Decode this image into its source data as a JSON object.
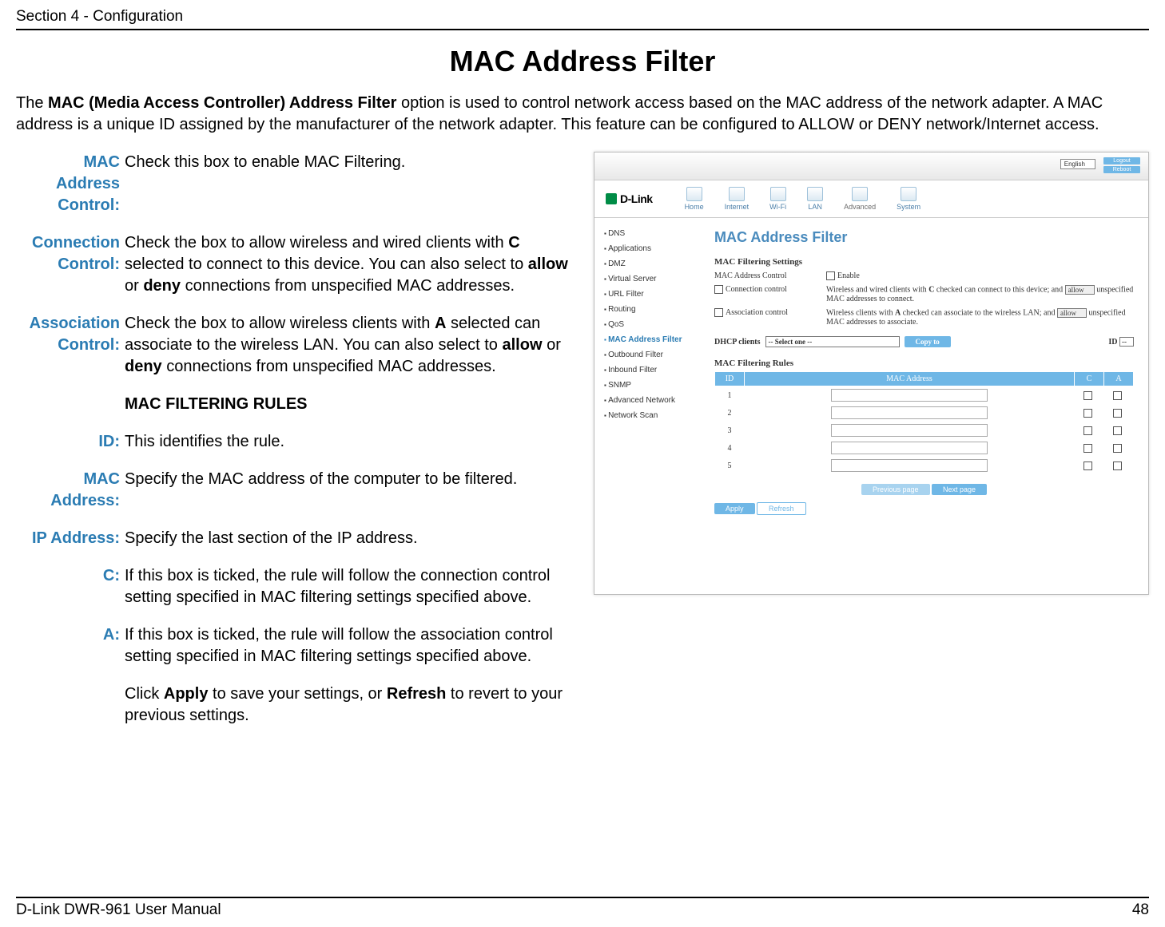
{
  "header": {
    "section": "Section 4 - Configuration"
  },
  "title": "MAC Address Filter",
  "intro": {
    "pre": "The ",
    "bold1": "MAC (Media Access Controller) Address Filter",
    "rest": " option is used to control network access based on the MAC address of the network adapter. A MAC address is a unique ID assigned by the manufacturer of the network adapter. This feature can be configured to ALLOW or DENY network/Internet access."
  },
  "defs": {
    "mac_addr_control": {
      "label": "MAC Address Control:",
      "body": "Check this box to enable MAC Filtering."
    },
    "connection_control": {
      "label": "Connection Control:",
      "body_pre": "Check the box to allow wireless and wired clients with ",
      "bold_c": "C",
      "body_mid": " selected to connect to this device. You can also select to ",
      "bold_allow": "allow",
      "or": " or ",
      "bold_deny": "deny",
      "body_post": " connections from unspecified MAC addresses."
    },
    "association_control": {
      "label": "Association Control:",
      "body_pre": "Check the box to allow wireless clients with ",
      "bold_a": "A",
      "body_mid": " selected can associate to the wireless LAN. You can also select to ",
      "bold_allow": "allow",
      "or": " or ",
      "bold_deny": "deny",
      "body_post": " connections from unspecified MAC addresses."
    },
    "rules_heading": "MAC FILTERING RULES",
    "id": {
      "label": "ID:",
      "body": "This identifies the rule."
    },
    "mac_address": {
      "label": "MAC Address:",
      "body": "Specify the MAC address of the computer to be filtered."
    },
    "ip_address": {
      "label": "IP Address:",
      "body": "Specify the last section of the IP address."
    },
    "c": {
      "label": "C:",
      "body": "If this box is ticked, the rule will follow the connection control setting specified in MAC filtering settings specified above."
    },
    "a": {
      "label": "A:",
      "body": "If this box is ticked, the rule will follow the association control setting specified in MAC filtering settings specified above."
    },
    "apply_note": {
      "pre": "Click ",
      "b1": "Apply",
      "mid": " to save your settings, or ",
      "b2": "Refresh",
      "post": " to revert to your previous settings."
    }
  },
  "screenshot": {
    "lang": "English",
    "logout": "Logout",
    "reboot": "Reboot",
    "logo": "D-Link",
    "tabs": [
      "Home",
      "Internet",
      "Wi-Fi",
      "LAN",
      "Advanced",
      "System"
    ],
    "sidebar": [
      "DNS",
      "Applications",
      "DMZ",
      "Virtual Server",
      "URL Filter",
      "Routing",
      "QoS",
      "MAC Address Filter",
      "Outbound Filter",
      "Inbound Filter",
      "SNMP",
      "Advanced Network",
      "Network Scan"
    ],
    "sidebar_active_index": 7,
    "page_title": "MAC Address Filter",
    "sec1": "MAC Filtering Settings",
    "mac_ctrl_label": "MAC Address Control",
    "enable": "Enable",
    "conn_ctrl_cb": "Connection control",
    "conn_ctrl_text_pre": "Wireless and wired clients with ",
    "conn_ctrl_c": "C",
    "conn_ctrl_text_mid": " checked can connect to this device; and ",
    "allow_opt": "allow",
    "conn_ctrl_text_post": " unspecified MAC addresses to connect.",
    "assoc_ctrl_cb": "Association control",
    "assoc_ctrl_text_pre": "Wireless clients with ",
    "assoc_ctrl_a": "A",
    "assoc_ctrl_text_mid": " checked can associate to the wireless LAN; and ",
    "assoc_ctrl_text_post": " unspecified MAC addresses to associate.",
    "dhcp_label": "DHCP clients",
    "dhcp_select": "-- Select one --",
    "copy_to": "Copy to",
    "id_label": "ID",
    "id_select": "--",
    "sec2": "MAC Filtering Rules",
    "th_id": "ID",
    "th_mac": "MAC Address",
    "th_c": "C",
    "th_a": "A",
    "rows": [
      "1",
      "2",
      "3",
      "4",
      "5"
    ],
    "prev": "Previous page",
    "next": "Next page",
    "apply": "Apply",
    "refresh": "Refresh"
  },
  "footer": {
    "left": "D-Link DWR-961 User Manual",
    "right": "48"
  }
}
